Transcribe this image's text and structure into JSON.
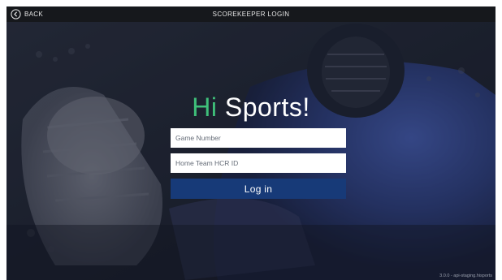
{
  "header": {
    "back_label": "BACK",
    "title": "SCOREKEEPER LOGIN",
    "back_icon": "chevron-left-circle-icon"
  },
  "logo": {
    "hi": "Hi",
    "sports": "Sports!",
    "hi_color": "#3fc07a"
  },
  "form": {
    "game_number_placeholder": "Game Number",
    "game_number_value": "",
    "hcr_id_placeholder": "Home Team HCR ID",
    "hcr_id_value": "",
    "login_label": "Log in",
    "login_color": "#173a78"
  },
  "footer": {
    "version": "3.0.0 - api-staging.hisports"
  }
}
